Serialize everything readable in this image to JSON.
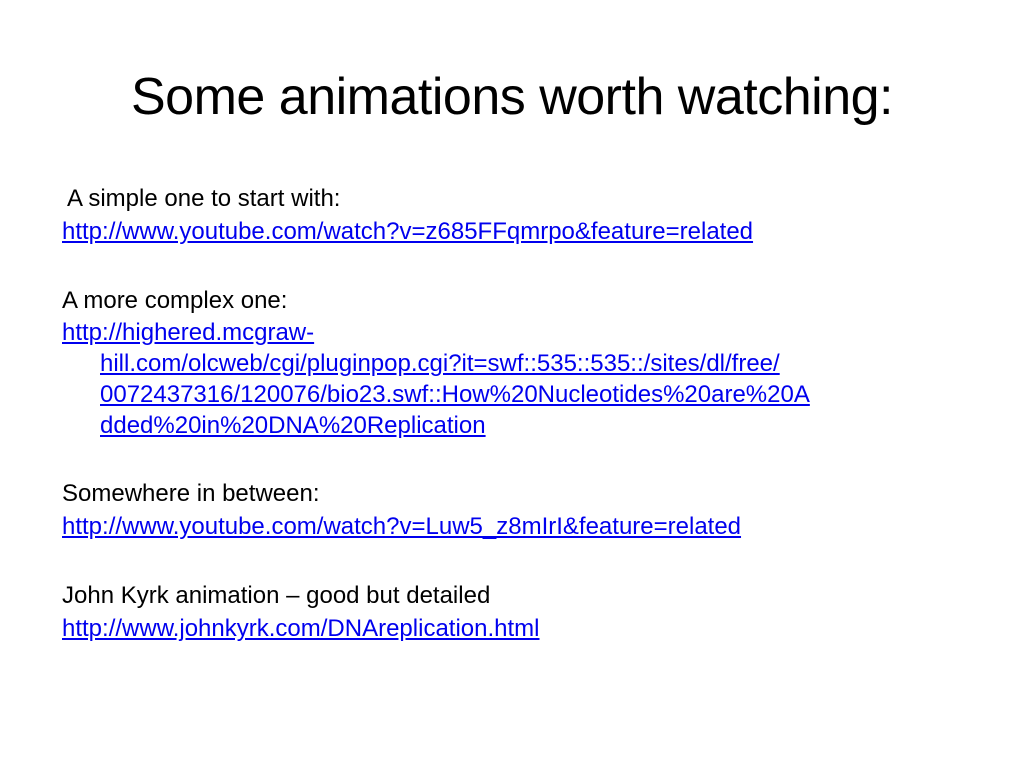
{
  "slide": {
    "title": "Some animations worth watching:",
    "sections": [
      {
        "label": "A simple one to start with:",
        "link": "http://www.youtube.com/watch?v=z685FFqmrpo&feature=related"
      },
      {
        "label": "A more complex one:",
        "link_lines": [
          "http://highered.mcgraw-",
          "hill.com/olcweb/cgi/pluginpop.cgi?it=swf::535::535::/sites/dl/free/",
          "0072437316/120076/bio23.swf::How%20Nucleotides%20are%20A",
          "dded%20in%20DNA%20Replication"
        ]
      },
      {
        "label": "Somewhere in between:",
        "link": "http://www.youtube.com/watch?v=Luw5_z8mIrI&feature=related"
      },
      {
        "label": "John Kyrk animation – good but detailed",
        "link": "http://www.johnkyrk.com/DNAreplication.html"
      }
    ]
  },
  "colors": {
    "link": "#0000ee",
    "text": "#000000",
    "background": "#ffffff"
  }
}
